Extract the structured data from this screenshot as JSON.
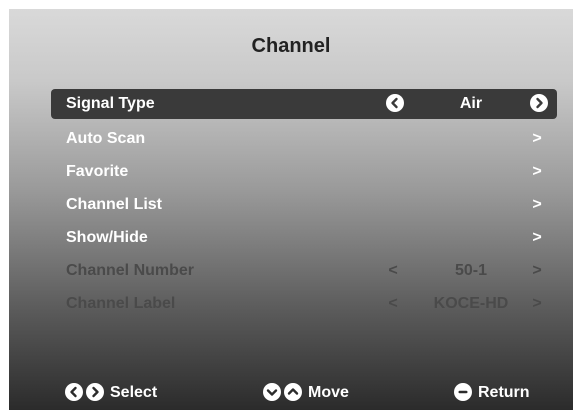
{
  "screen": {
    "title": "Channel"
  },
  "menu": {
    "items": [
      {
        "label": "Signal Type",
        "value": "Air",
        "state": "selected",
        "prev_icon": "circle-left-icon",
        "next_icon": "circle-right-icon"
      },
      {
        "label": "Auto Scan",
        "value": "",
        "state": "enabled",
        "next_icon": "chevron-right-icon",
        "next_glyph": ">"
      },
      {
        "label": "Favorite",
        "value": "",
        "state": "enabled",
        "next_icon": "chevron-right-icon",
        "next_glyph": ">"
      },
      {
        "label": "Channel List",
        "value": "",
        "state": "enabled",
        "next_icon": "chevron-right-icon",
        "next_glyph": ">"
      },
      {
        "label": "Show/Hide",
        "value": "",
        "state": "enabled",
        "next_icon": "chevron-right-icon",
        "next_glyph": ">"
      },
      {
        "label": "Channel Number",
        "value": "50-1",
        "state": "disabled",
        "prev_glyph": "<",
        "next_glyph": ">"
      },
      {
        "label": "Channel Label",
        "value": "KOCE-HD",
        "state": "disabled",
        "prev_glyph": "<",
        "next_glyph": ">"
      }
    ]
  },
  "footer": {
    "select_label": "Select",
    "move_label": "Move",
    "return_label": "Return"
  },
  "colors": {
    "selected_row_bg": "#3a3a3a",
    "enabled_text": "#ffffff",
    "disabled_text": "#4a4a4a",
    "title_text": "#222222"
  }
}
